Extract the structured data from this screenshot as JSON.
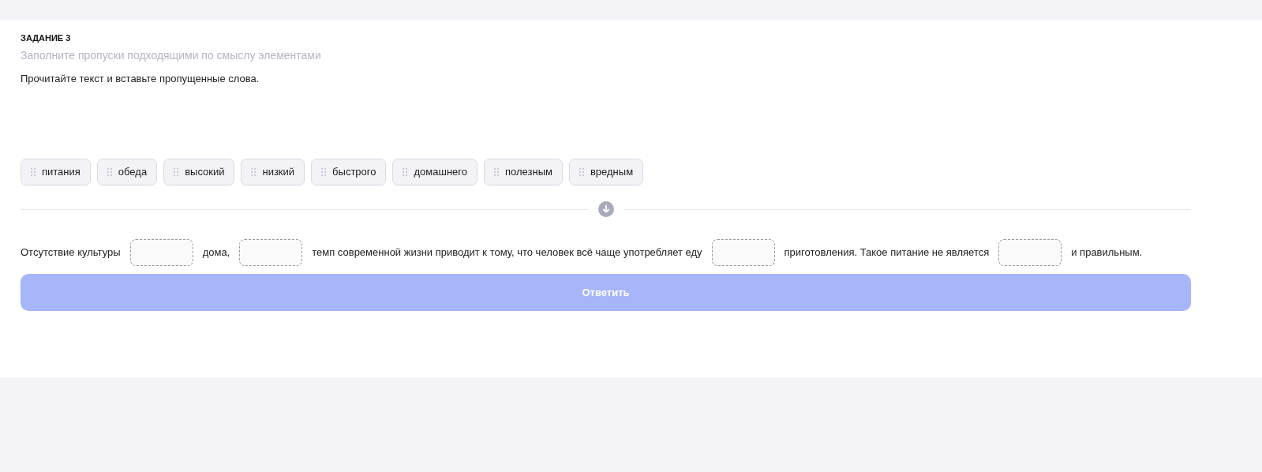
{
  "task": {
    "title": "ЗАДАНИЕ 3",
    "subtitle": "Заполните пропуски подходящими по смыслу элементами",
    "instruction": "Прочитайте текст и вставьте пропущенные слова."
  },
  "words": [
    "питания",
    "обеда",
    "высокий",
    "низкий",
    "быстрого",
    "домашнего",
    "полезным",
    "вредным"
  ],
  "sentence": [
    {
      "kind": "text",
      "text": "Отсутствие культуры"
    },
    {
      "kind": "blank"
    },
    {
      "kind": "text",
      "text": "дома,"
    },
    {
      "kind": "blank"
    },
    {
      "kind": "text",
      "text": "темп современной жизни приводит к тому, что человек всё чаще употребляет еду"
    },
    {
      "kind": "blank"
    },
    {
      "kind": "text",
      "text": "приготовления. Такое питание не является"
    },
    {
      "kind": "blank"
    },
    {
      "kind": "text",
      "text": "и правильным."
    }
  ],
  "submit": {
    "label": "Ответить",
    "disabled": true
  }
}
